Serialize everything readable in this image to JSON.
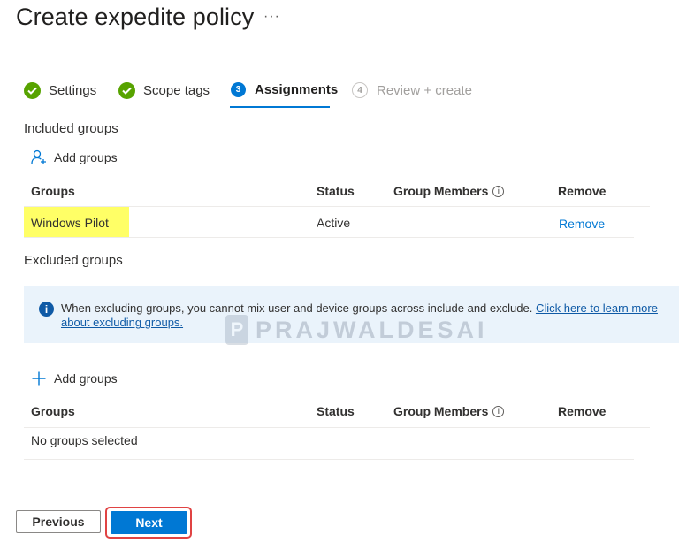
{
  "header": {
    "title": "Create expedite policy",
    "more_label": "···"
  },
  "steps": [
    {
      "label": "Settings",
      "state": "completed"
    },
    {
      "label": "Scope tags",
      "state": "completed"
    },
    {
      "label": "Assignments",
      "state": "active",
      "number": "3"
    },
    {
      "label": "Review + create",
      "state": "disabled",
      "number": "4"
    }
  ],
  "included": {
    "label": "Included groups",
    "add_label": "Add groups",
    "columns": [
      "Groups",
      "Status",
      "Group Members",
      "Remove"
    ],
    "rows": [
      {
        "group": "Windows Pilot",
        "status": "Active",
        "members": "",
        "remove": "Remove"
      }
    ]
  },
  "excluded": {
    "label": "Excluded groups",
    "info_text": "When excluding groups, you cannot mix user and device groups across include and exclude.",
    "info_link": "Click here to learn more about excluding groups.",
    "add_label": "Add groups",
    "columns": [
      "Groups",
      "Status",
      "Group Members",
      "Remove"
    ],
    "empty_text": "No groups selected"
  },
  "watermark": {
    "logo_letter": "P",
    "text": "PRAJWALDESAI"
  },
  "footer": {
    "previous_label": "Previous",
    "next_label": "Next"
  },
  "colors": {
    "accent": "#0078d4",
    "success": "#57a300",
    "highlight": "#ffff66",
    "callout_border": "#e04343"
  }
}
